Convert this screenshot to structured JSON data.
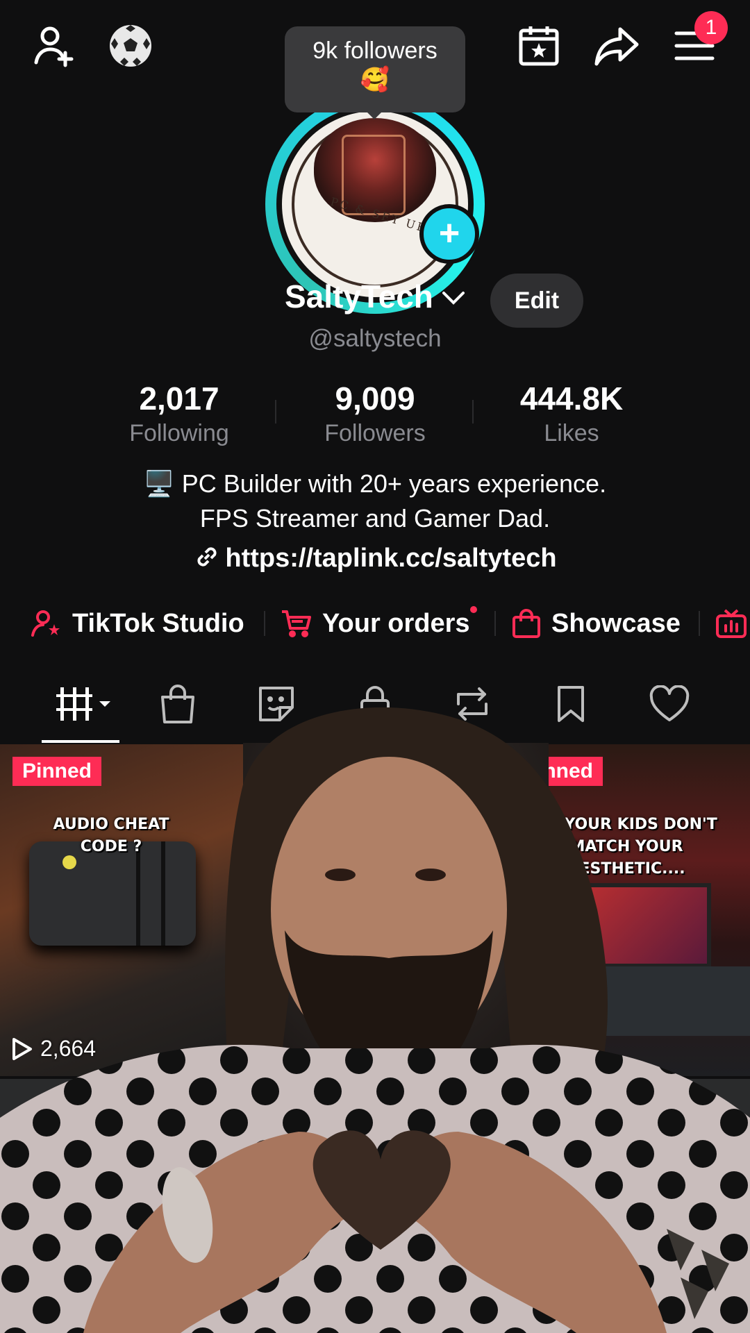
{
  "header": {
    "tooltip_text": "9k followers",
    "tooltip_emoji": "🥰",
    "notification_count": "1"
  },
  "avatar": {
    "logo_text": "PC & SET UP"
  },
  "profile": {
    "display_name": "SaltyTech",
    "username": "@saltystech",
    "edit_label": "Edit"
  },
  "stats": [
    {
      "value": "2,017",
      "label": "Following"
    },
    {
      "value": "9,009",
      "label": "Followers"
    },
    {
      "value": "444.8K",
      "label": "Likes"
    }
  ],
  "bio": {
    "line1": "PC Builder with 20+ years experience.",
    "line1_emoji": "🖥️",
    "line2": "FPS Streamer and Gamer Dad.",
    "link": "https://taplink.cc/saltytech"
  },
  "shortcuts": [
    {
      "label": "TikTok Studio"
    },
    {
      "label": "Your orders"
    },
    {
      "label": "Showcase"
    }
  ],
  "tabs": [
    "videos",
    "shop",
    "reposts-sticker",
    "private",
    "reposts",
    "favorites",
    "liked"
  ],
  "videos": [
    {
      "badge": "Pinned",
      "caption": "AUDIO CHEAT CODE ?",
      "views": "2,664"
    },
    {
      "badge": "Pinned",
      "caption": "EN YOUR KIDS DON'T MATCH YOUR AESTHETIC....",
      "views": ""
    }
  ],
  "colors": {
    "accent": "#fe2c55",
    "ring": "#20d5ec",
    "muted": "#8a8b91"
  }
}
